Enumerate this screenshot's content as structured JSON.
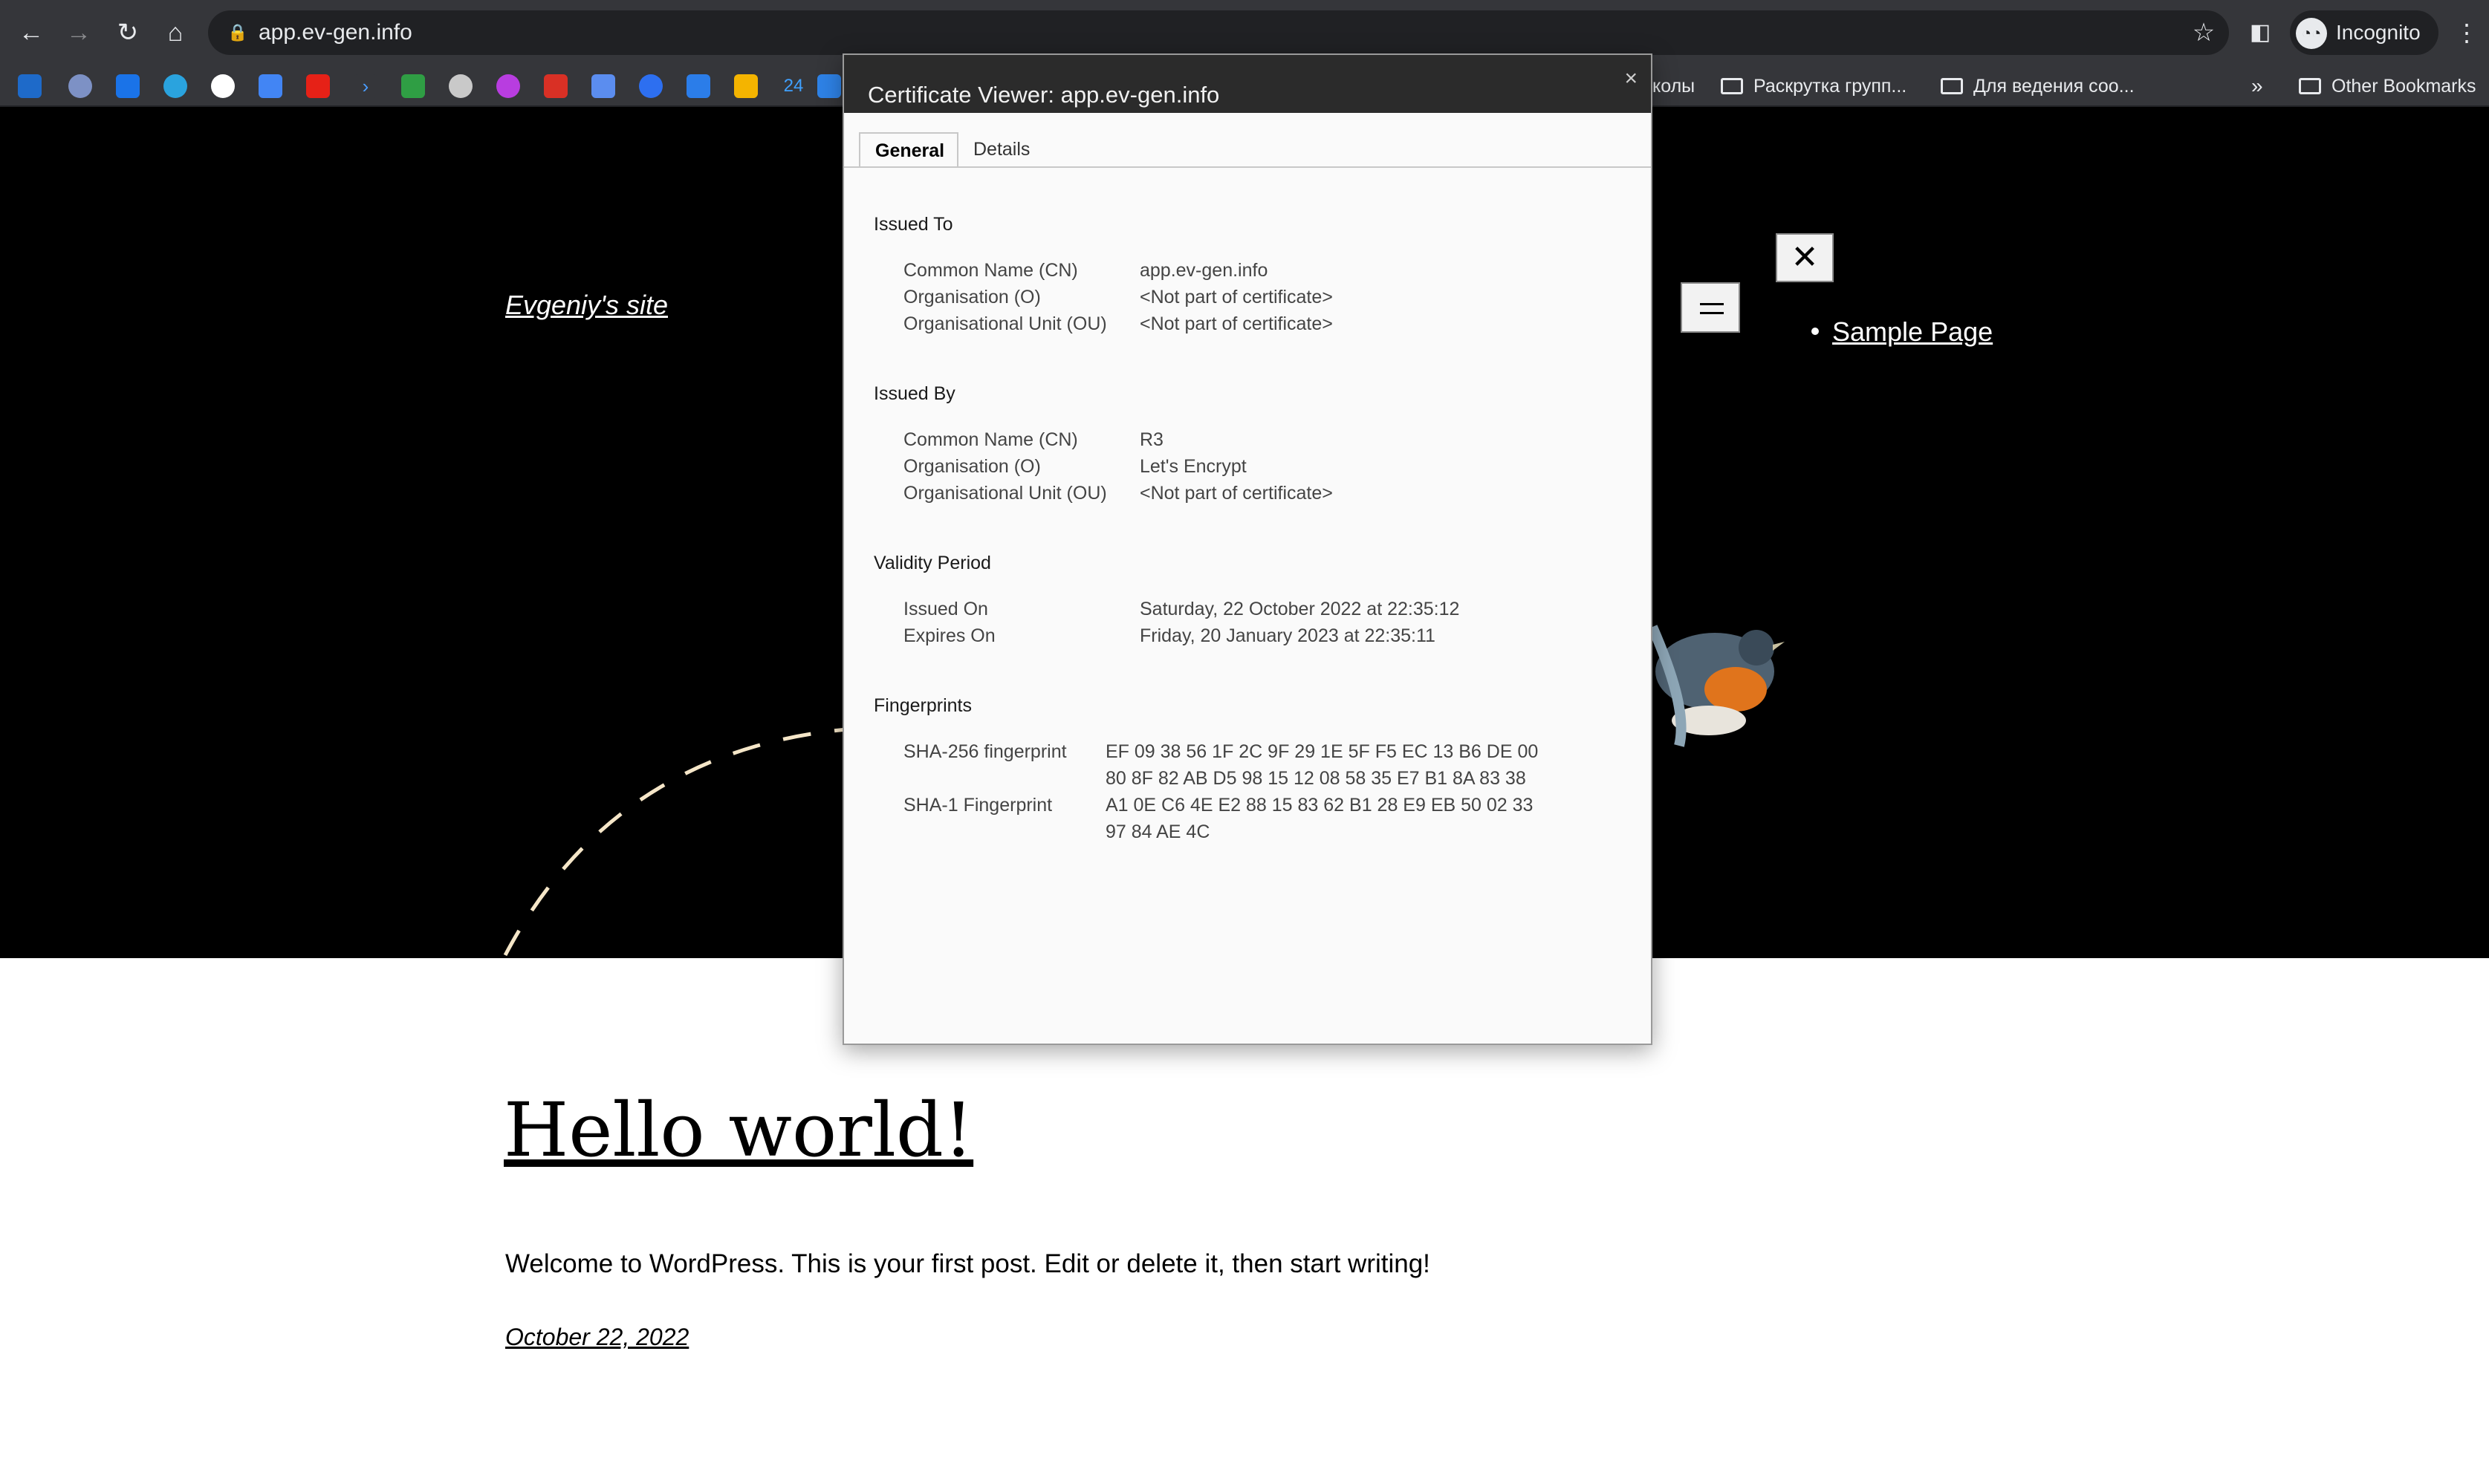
{
  "browser": {
    "url": "app.ev-gen.info",
    "profile_label": "Incognito",
    "icons": {
      "back": "arrow-left-icon",
      "forward": "arrow-right-icon",
      "reload": "reload-icon",
      "home": "home-icon",
      "lock": "lock-icon",
      "bookmark_star": "star-icon",
      "side_panel": "side-panel-icon",
      "menu": "kebab-menu-icon"
    }
  },
  "bookmarks": {
    "folders": [
      "колы",
      "Раскрутка групп...",
      "Для ведения соо..."
    ],
    "overflow": "»",
    "other": "Other Bookmarks"
  },
  "site": {
    "title": "Evgeniy's site",
    "menu_items": [
      "Sample Page"
    ],
    "close_glyph": "✕"
  },
  "post": {
    "title": "Hello world!",
    "body": "Welcome to WordPress. This is your first post. Edit or delete it, then start writing!",
    "date": "October 22, 2022"
  },
  "certificate": {
    "window_title": "Certificate Viewer: app.ev-gen.info",
    "close_glyph": "×",
    "tabs": [
      "General",
      "Details"
    ],
    "active_tab": "General",
    "issued_to": {
      "heading": "Issued To",
      "rows": [
        {
          "label": "Common Name (CN)",
          "value": "app.ev-gen.info"
        },
        {
          "label": "Organisation (O)",
          "value": "<Not part of certificate>"
        },
        {
          "label": "Organisational Unit (OU)",
          "value": "<Not part of certificate>"
        }
      ]
    },
    "issued_by": {
      "heading": "Issued By",
      "rows": [
        {
          "label": "Common Name (CN)",
          "value": "R3"
        },
        {
          "label": "Organisation (O)",
          "value": "Let's Encrypt"
        },
        {
          "label": "Organisational Unit (OU)",
          "value": "<Not part of certificate>"
        }
      ]
    },
    "validity": {
      "heading": "Validity Period",
      "rows": [
        {
          "label": "Issued On",
          "value": "Saturday, 22 October 2022 at 22:35:12"
        },
        {
          "label": "Expires On",
          "value": "Friday, 20 January 2023 at 22:35:11"
        }
      ]
    },
    "fingerprints": {
      "heading": "Fingerprints",
      "rows": [
        {
          "label": "SHA-256 fingerprint",
          "line1": "EF 09 38 56 1F 2C 9F 29 1E 5F F5 EC 13 B6 DE 00",
          "line2": "80 8F 82 AB D5 98 15 12 08 58 35 E7 B1 8A 83 38"
        },
        {
          "label": "SHA-1 Fingerprint",
          "line1": "A1 0E C6 4E E2 88 15 83 62 B1 28 E9 EB 50 02 33",
          "line2": "97 84 AE 4C"
        }
      ]
    }
  }
}
